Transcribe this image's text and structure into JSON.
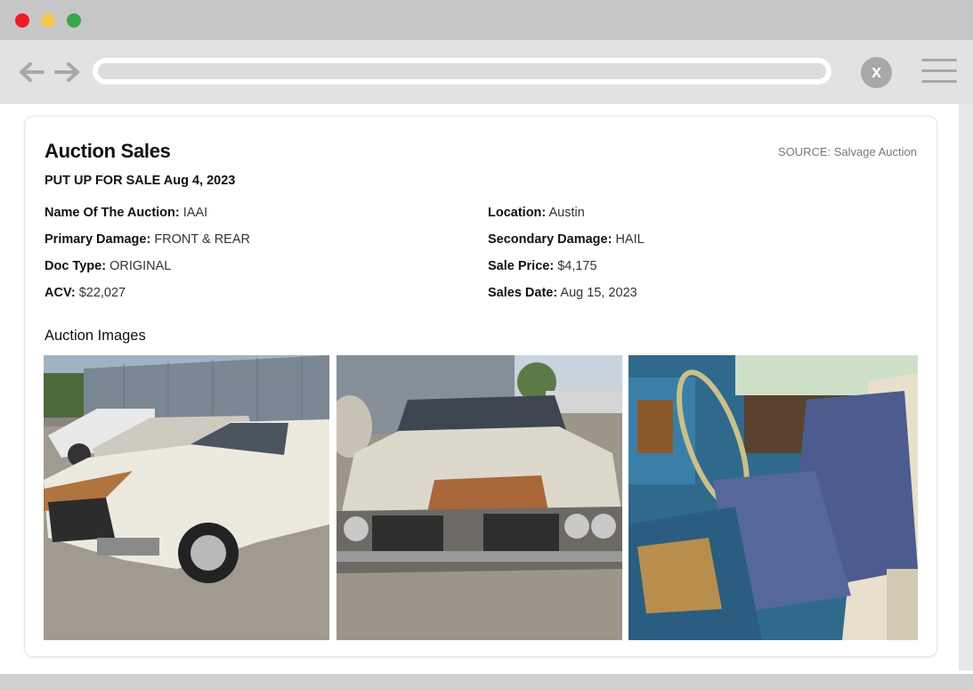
{
  "window": {
    "controls": [
      "close",
      "minimize",
      "maximize"
    ],
    "colors": {
      "close": "#ee1c2b",
      "minimize": "#f6c54c",
      "maximize": "#3aa84a"
    }
  },
  "toolbar": {
    "back_icon": "arrow-left-icon",
    "forward_icon": "arrow-right-icon",
    "close_glyph": "x",
    "menu_icon": "hamburger-icon"
  },
  "card": {
    "title": "Auction Sales",
    "source": "SOURCE: Salvage Auction",
    "put_up": "PUT UP FOR SALE Aug 4, 2023",
    "fields": [
      {
        "label": "Name Of The Auction:",
        "value": "IAAI"
      },
      {
        "label": "Location:",
        "value": "Austin"
      },
      {
        "label": "Primary Damage:",
        "value": "FRONT & REAR"
      },
      {
        "label": "Secondary Damage:",
        "value": "HAIL"
      },
      {
        "label": "Doc Type:",
        "value": "ORIGINAL"
      },
      {
        "label": "Sale Price:",
        "value": "$4,175"
      },
      {
        "label": "ACV:",
        "value": "$22,027"
      },
      {
        "label": "Sales Date:",
        "value": "Aug 15, 2023"
      }
    ],
    "images_title": "Auction Images"
  }
}
